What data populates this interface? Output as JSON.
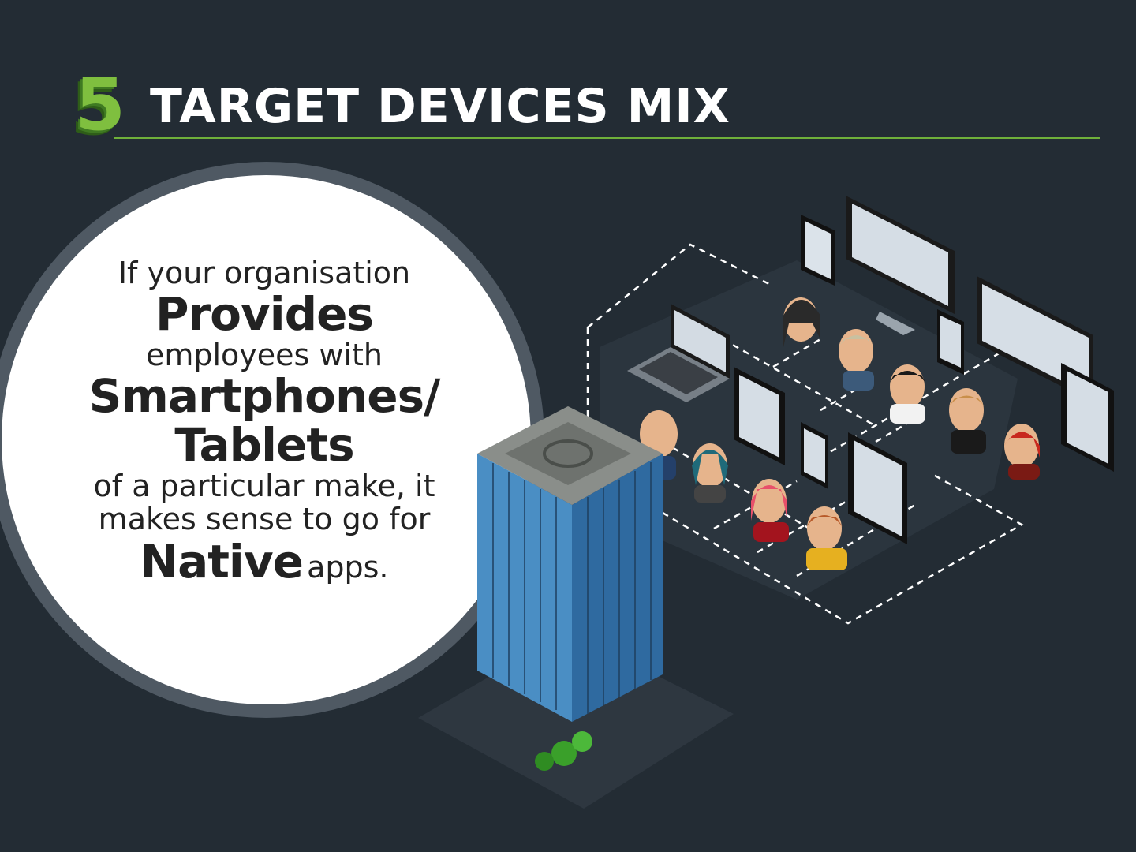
{
  "header": {
    "number": "5",
    "title": "TARGET DEVICES MIX"
  },
  "copy": {
    "line1": "If your organisation",
    "line2": "Provides",
    "line3": "employees with",
    "line4": "Smartphones/",
    "line5": "Tablets",
    "line6": "of a particular make, it",
    "line7": "makes sense to go for",
    "line8a": "Native",
    "line8b": "apps."
  },
  "colors": {
    "background": "#232c34",
    "accent": "#7fbf3f",
    "circle": "#ffffff",
    "text": "#222222"
  },
  "illustration": {
    "building_icon": "skyscraper-icon",
    "people_icon": "people-icon",
    "devices_icon": "devices-icon"
  }
}
